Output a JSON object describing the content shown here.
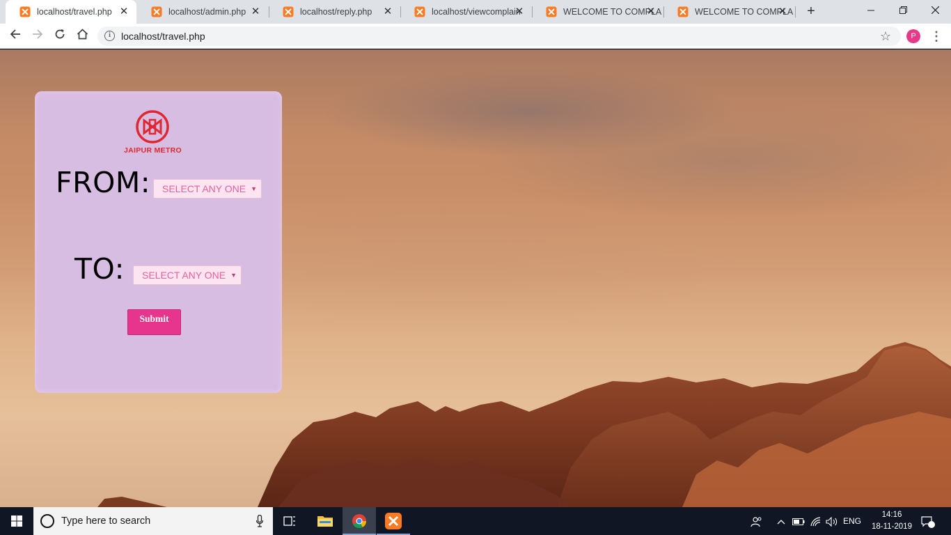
{
  "browser": {
    "tabs": [
      {
        "title": "localhost/travel.php",
        "active": true
      },
      {
        "title": "localhost/admin.php",
        "active": false
      },
      {
        "title": "localhost/reply.php",
        "active": false
      },
      {
        "title": "localhost/viewcomplain",
        "active": false
      },
      {
        "title": "WELCOME TO COMPLA",
        "active": false
      },
      {
        "title": "WELCOME TO COMPLA",
        "active": false
      }
    ],
    "tab_close_glyph": "✕",
    "new_tab_glyph": "+",
    "url": "localhost/travel.php",
    "profile_initial": "P",
    "accent_color": "#e8388a"
  },
  "page": {
    "logo_text": "JAIPUR METRO",
    "from_label": "FROM:",
    "to_label": "TO:",
    "from_select": {
      "selected": "SELECT ANY ONE"
    },
    "to_select": {
      "selected": "SELECT ANY ONE"
    },
    "submit_label": "Submit",
    "colors": {
      "panel": "#d8bde3",
      "button": "#e7358d",
      "select_text": "#e8609a",
      "logo": "#e0262f"
    }
  },
  "taskbar": {
    "search_placeholder": "Type here to search",
    "language": "ENG",
    "time": "14:16",
    "date": "18-11-2019",
    "notification_count": "1"
  }
}
